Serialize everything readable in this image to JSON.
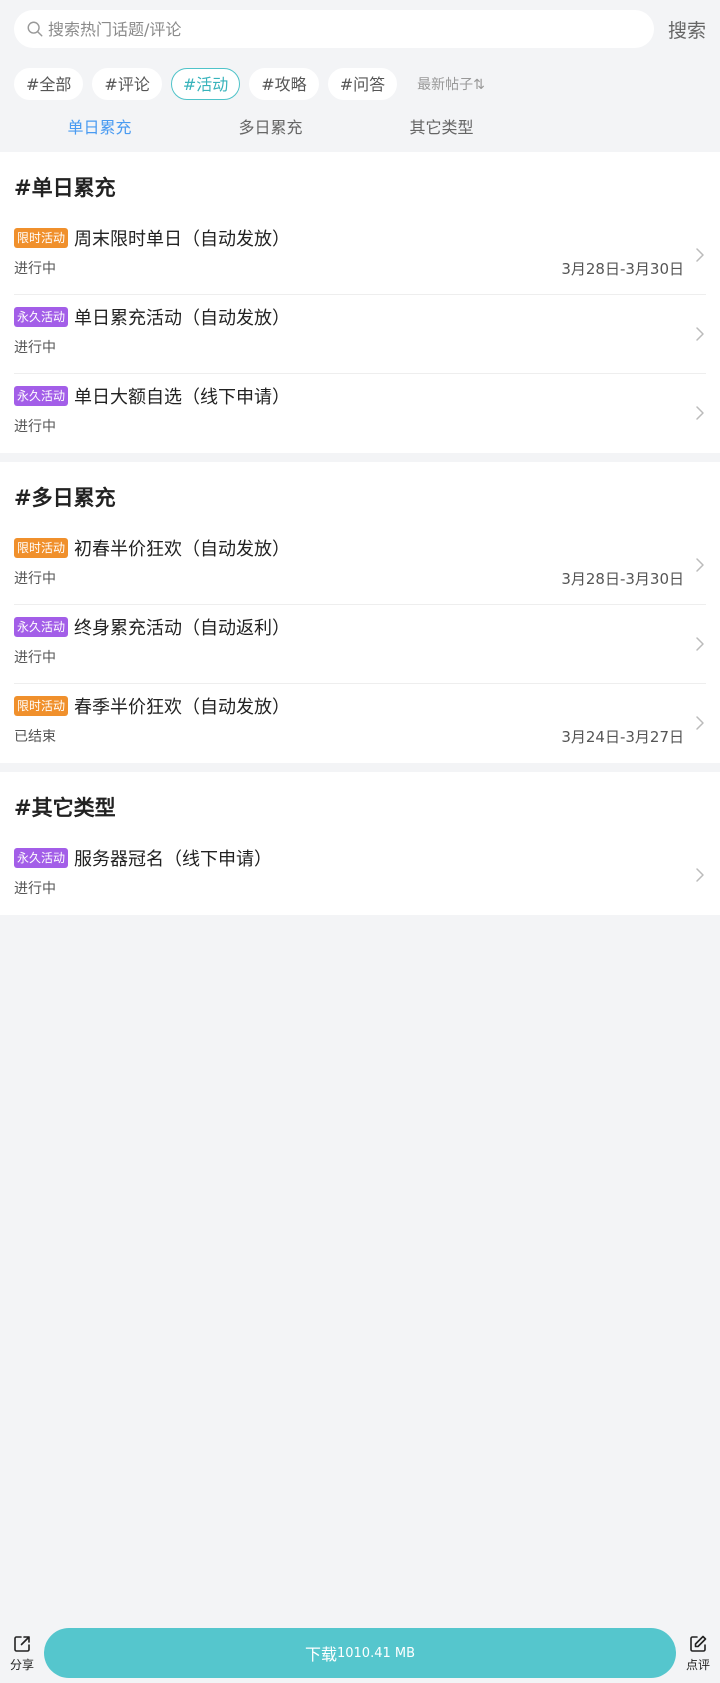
{
  "search": {
    "placeholder": "搜索热门话题/评论",
    "button_label": "搜索"
  },
  "filters": {
    "chips": [
      "#全部",
      "#评论",
      "#活动",
      "#攻略",
      "#问答"
    ],
    "active_index": 2,
    "sort_label": "最新帖子",
    "sort_icon": "⇅"
  },
  "tabs": [
    {
      "label": "单日累充",
      "active": true
    },
    {
      "label": "多日累充",
      "active": false
    },
    {
      "label": "其它类型",
      "active": false
    }
  ],
  "sections": [
    {
      "title": "#单日累充",
      "items": [
        {
          "tag": "限时活动",
          "tag_color": "#f0902c",
          "title": "周末限时单日（自动发放）",
          "status": "进行中",
          "date": "3月28日-3月30日"
        },
        {
          "tag": "永久活动",
          "tag_color": "#a35ee8",
          "title": "单日累充活动（自动发放）",
          "status": "进行中",
          "date": ""
        },
        {
          "tag": "永久活动",
          "tag_color": "#a35ee8",
          "title": "单日大额自选（线下申请）",
          "status": "进行中",
          "date": ""
        }
      ]
    },
    {
      "title": "#多日累充",
      "items": [
        {
          "tag": "限时活动",
          "tag_color": "#f0902c",
          "title": "初春半价狂欢（自动发放）",
          "status": "进行中",
          "date": "3月28日-3月30日"
        },
        {
          "tag": "永久活动",
          "tag_color": "#a35ee8",
          "title": "终身累充活动（自动返利）",
          "status": "进行中",
          "date": ""
        },
        {
          "tag": "限时活动",
          "tag_color": "#f0902c",
          "title": "春季半价狂欢（自动发放）",
          "status": "已结束",
          "date": "3月24日-3月27日"
        }
      ]
    },
    {
      "title": "#其它类型",
      "items": [
        {
          "tag": "永久活动",
          "tag_color": "#a35ee8",
          "title": "服务器冠名（线下申请）",
          "status": "进行中",
          "date": ""
        }
      ]
    }
  ],
  "bottom_bar": {
    "share_label": "分享",
    "download_label": "下载",
    "download_size": "1010.41 MB",
    "review_label": "点评"
  },
  "colors": {
    "accent": "#55c6cd",
    "tab_active": "#4a9bf1",
    "limited_tag": "#f0902c",
    "permanent_tag": "#a35ee8"
  }
}
